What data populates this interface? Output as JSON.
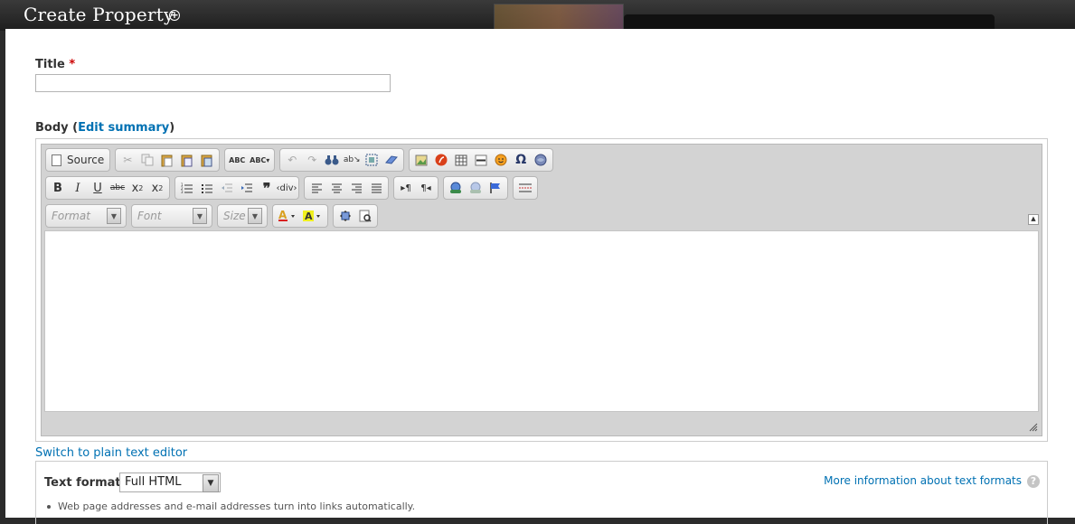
{
  "overlay": {
    "title": "Create Property",
    "add_icon_glyph": "+"
  },
  "form": {
    "title_label": "Title",
    "required_mark": "*",
    "title_value": "",
    "body_label": "Body",
    "edit_summary": "Edit summary",
    "paren_open": "(",
    "paren_close": ")"
  },
  "toolbar": {
    "source_label": "Source",
    "format_placeholder": "Format",
    "font_placeholder": "Font",
    "size_placeholder": "Size",
    "abc": "ABC",
    "sub": "x",
    "sup": "x",
    "bold": "B",
    "italic": "I",
    "underline": "U",
    "strike": "abc"
  },
  "editor": {
    "switch_link": "Switch to plain text editor"
  },
  "text_format": {
    "label": "Text format",
    "selected": "Full HTML",
    "more_info": "More information about text formats",
    "help_glyph": "?",
    "tip": "Web page addresses and e-mail addresses turn into links automatically."
  },
  "colors": {
    "link": "#0071b3",
    "required": "#cc0000"
  }
}
